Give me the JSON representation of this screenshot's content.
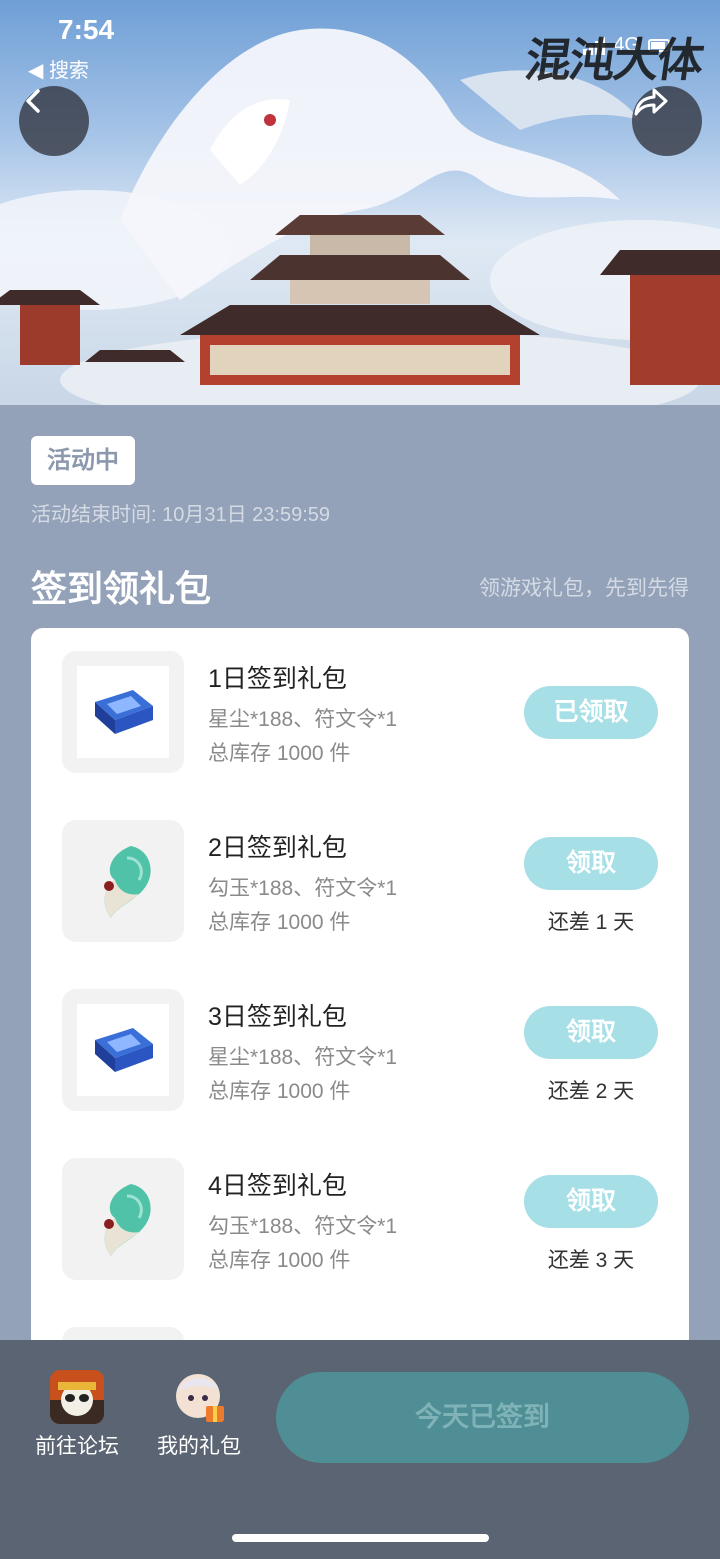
{
  "status_bar": {
    "time": "7:54",
    "back_label": "搜索",
    "network": "4G"
  },
  "hero": {
    "logo_text": "混沌大体"
  },
  "activity": {
    "badge": "活动中",
    "end_time": "活动结束时间: 10月31日 23:59:59"
  },
  "section": {
    "title": "签到领礼包",
    "subtitle": "领游戏礼包，先到先得"
  },
  "gifts": [
    {
      "title": "1日签到礼包",
      "desc": "星尘*188、符文令*1",
      "stock": "总库存 1000 件",
      "button": "已领取",
      "remain": "",
      "icon": "blue-crystal-icon"
    },
    {
      "title": "2日签到礼包",
      "desc": "勾玉*188、符文令*1",
      "stock": "总库存 1000 件",
      "button": "领取",
      "remain": "还差 1 天",
      "icon": "jade-magatama-icon"
    },
    {
      "title": "3日签到礼包",
      "desc": "星尘*188、符文令*1",
      "stock": "总库存 1000 件",
      "button": "领取",
      "remain": "还差 2 天",
      "icon": "blue-crystal-icon"
    },
    {
      "title": "4日签到礼包",
      "desc": "勾玉*188、符文令*1",
      "stock": "总库存 1000 件",
      "button": "领取",
      "remain": "还差 3 天",
      "icon": "jade-magatama-icon"
    }
  ],
  "bottom_bar": {
    "forum_label": "前往论坛",
    "gifts_label": "我的礼包",
    "checkin_label": "今天已签到"
  },
  "colors": {
    "page_bg": "#93a2b9",
    "button_light": "#a6dfe6",
    "checkin_bg": "#4e8e94",
    "bottom_bar": "#5a6472"
  }
}
